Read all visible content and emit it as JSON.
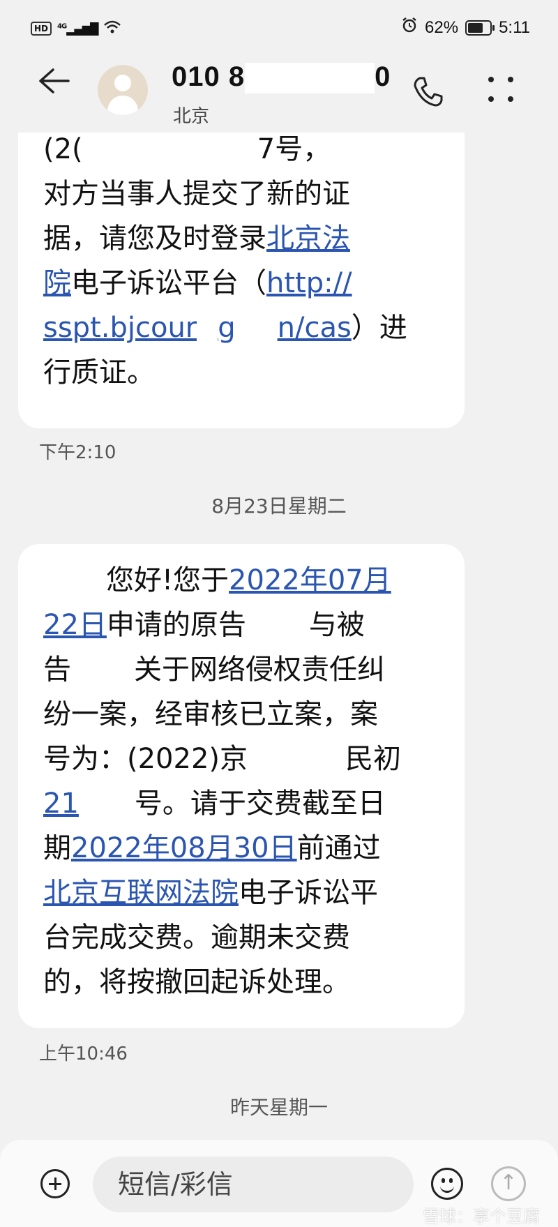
{
  "status": {
    "hd": "HD",
    "network": "4G",
    "battery": "62%",
    "time": "5:11"
  },
  "header": {
    "name_start": "010 8",
    "name_end": "0",
    "location": "北京"
  },
  "msg1": {
    "l1a": "(2(",
    "l1b": "7号，",
    "l2": "对方当事人提交了新的证",
    "l3a": "据，请您及时登录",
    "l3link": "北京法",
    "l4link": "院",
    "l4b": "电子诉讼平台（",
    "l4link2": "http://",
    "l5link_a": "sspt.bjcour",
    "l5link_b": "g",
    "l5link_c": "n/cas",
    "l5b": "）进",
    "l6": "行质证。",
    "time": "下午2:10"
  },
  "date_sep_1": "8月23日星期二",
  "msg2": {
    "l1a": "您好!您于",
    "l1link": "2022年07月",
    "l2link": "22日",
    "l2a": "申请的原告",
    "l2b": "与被",
    "l3a": "告",
    "l3b": "关于网络侵权责任纠",
    "l4": "纷一案，经审核已立案，案",
    "l5a": "号为：(2022)京",
    "l5b": "民初",
    "l6link": "21",
    "l6b": "号。请于交费截至日",
    "l7a": "期",
    "l7link": "2022年08月30日",
    "l7b": "前通过",
    "l8link": "北京互联网法院",
    "l8b": "电子诉讼平",
    "l9": "台完成交费。逾期未交费",
    "l10": "的，将按撤回起诉处理。",
    "time": "上午10:46"
  },
  "date_sep_2": "昨天星期一",
  "input": {
    "placeholder": "短信/彩信"
  },
  "watermark": "雪球：享个豆腐"
}
